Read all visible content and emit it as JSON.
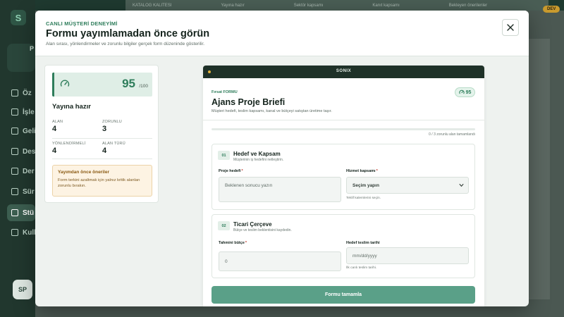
{
  "background": {
    "topbar": [
      "KATALOG KALITESI",
      "Yayına hazır",
      "Sektör kapsamı",
      "Kanıt kapsamı",
      "Bekleyen önerilenler"
    ],
    "sidebar_items": [
      "Öz",
      "İşle",
      "Geli",
      "Des",
      "Der",
      "Sür",
      "Stü",
      "Kull"
    ],
    "workspace_initial": "P",
    "avatar_initials": "SP",
    "dev_badge": "DEV"
  },
  "modal": {
    "eyebrow": "CANLI MÜŞTERİ DENEYİMİ",
    "title": "Formu yayımlamadan önce görün",
    "subtitle": "Alan sırası, yönlendirmeler ve zorunlu bilgiler gerçek form düzeninde gösterilir."
  },
  "score_panel": {
    "score": "95",
    "max": "/100",
    "ready_label": "Yayına hazır",
    "stats": [
      {
        "label": "ALAN",
        "value": "4"
      },
      {
        "label": "ZORUNLU",
        "value": "3"
      },
      {
        "label": "YÖNLENDİRMELİ",
        "value": "4"
      },
      {
        "label": "ALAN TÜRÜ",
        "value": "4"
      }
    ],
    "advice_title": "Yayımdan önce öneriler",
    "advice_text": "Form terkini azaltmak için yalnız kritik alanları zorunlu bırakın."
  },
  "preview": {
    "brand": "SONIX",
    "eyebrow": "Fırsat FORMU",
    "title": "Ajans Proje Briefi",
    "description": "Müşteri hedefi, teslim kapsamı, kanal ve bütçeyi satıştan üretime taşır.",
    "score_badge": "95",
    "progress_fraction": 0,
    "progress_text": "0 / 3 zorunlu alan tamamlandı",
    "sections": [
      {
        "number": "01",
        "title": "Hedef ve Kapsam",
        "description": "Müşterinin iş hedefini netleştirin.",
        "fields": [
          {
            "label": "Proje hedefi",
            "placeholder": "Beklenen sonucu yazın",
            "help": ""
          },
          {
            "label": "Hizmet kapsamı",
            "placeholder": "Seçim yapın",
            "help": "Teklif kalemlerini seçin."
          }
        ]
      },
      {
        "number": "02",
        "title": "Ticari Çerçeve",
        "description": "Bütçe ve teslim beklentisini kaydedin.",
        "fields": [
          {
            "label": "Tahmini bütçe",
            "placeholder": "0",
            "help": ""
          },
          {
            "label": "Hedef teslim tarihi",
            "placeholder": "mm/dd/yyyy",
            "help": "İlk canlı teslim tarihi."
          }
        ]
      }
    ],
    "submit_label": "Formu tamamla"
  },
  "colors": {
    "accent": "#2e7d5b",
    "submit": "#5aa088",
    "dark": "#1e3128",
    "warning_bg": "#fdf3e3"
  },
  "icons": [
    "gauge-icon",
    "close-icon",
    "chevron-down-icon",
    "refresh-icon"
  ]
}
